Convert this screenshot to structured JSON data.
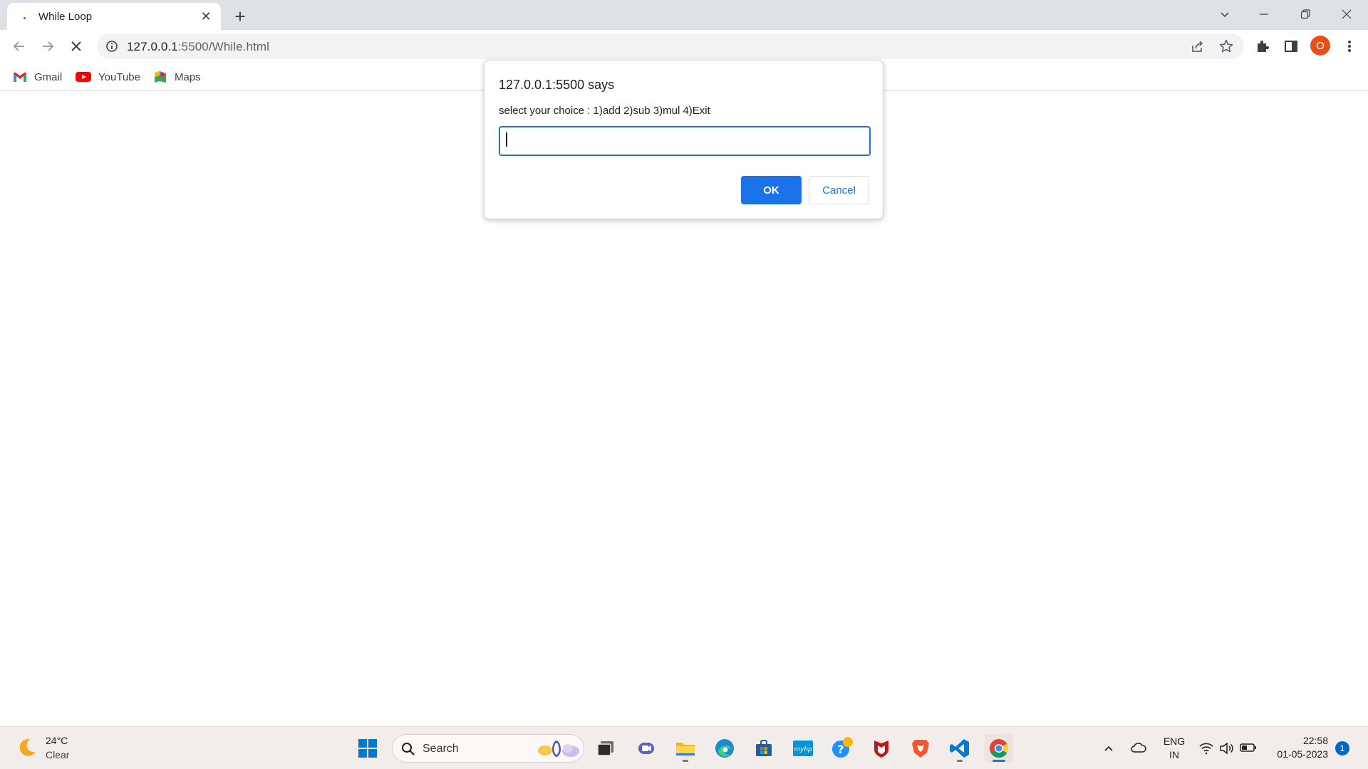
{
  "tab": {
    "title": "While Loop"
  },
  "address": {
    "host": "127.0.0.1",
    "path": ":5500/While.html"
  },
  "bookmarks": [
    {
      "label": "Gmail",
      "icon": "gmail-icon"
    },
    {
      "label": "YouTube",
      "icon": "youtube-icon"
    },
    {
      "label": "Maps",
      "icon": "maps-icon"
    }
  ],
  "dialog": {
    "title": "127.0.0.1:5500 says",
    "message": "select your choice : 1)add 2)sub 3)mul 4)Exit",
    "input_value": "",
    "ok_label": "OK",
    "cancel_label": "Cancel"
  },
  "profile": {
    "initial": "O"
  },
  "taskbar": {
    "weather": {
      "temp": "24°C",
      "condition": "Clear"
    },
    "search_label": "Search",
    "language": {
      "line1": "ENG",
      "line2": "IN"
    },
    "clock": {
      "time": "22:58",
      "date": "01-05-2023"
    },
    "notification_count": "1"
  },
  "colors": {
    "accent": "#1a73e8",
    "avatar": "#e8501a",
    "taskbar": "#f2ecea"
  }
}
